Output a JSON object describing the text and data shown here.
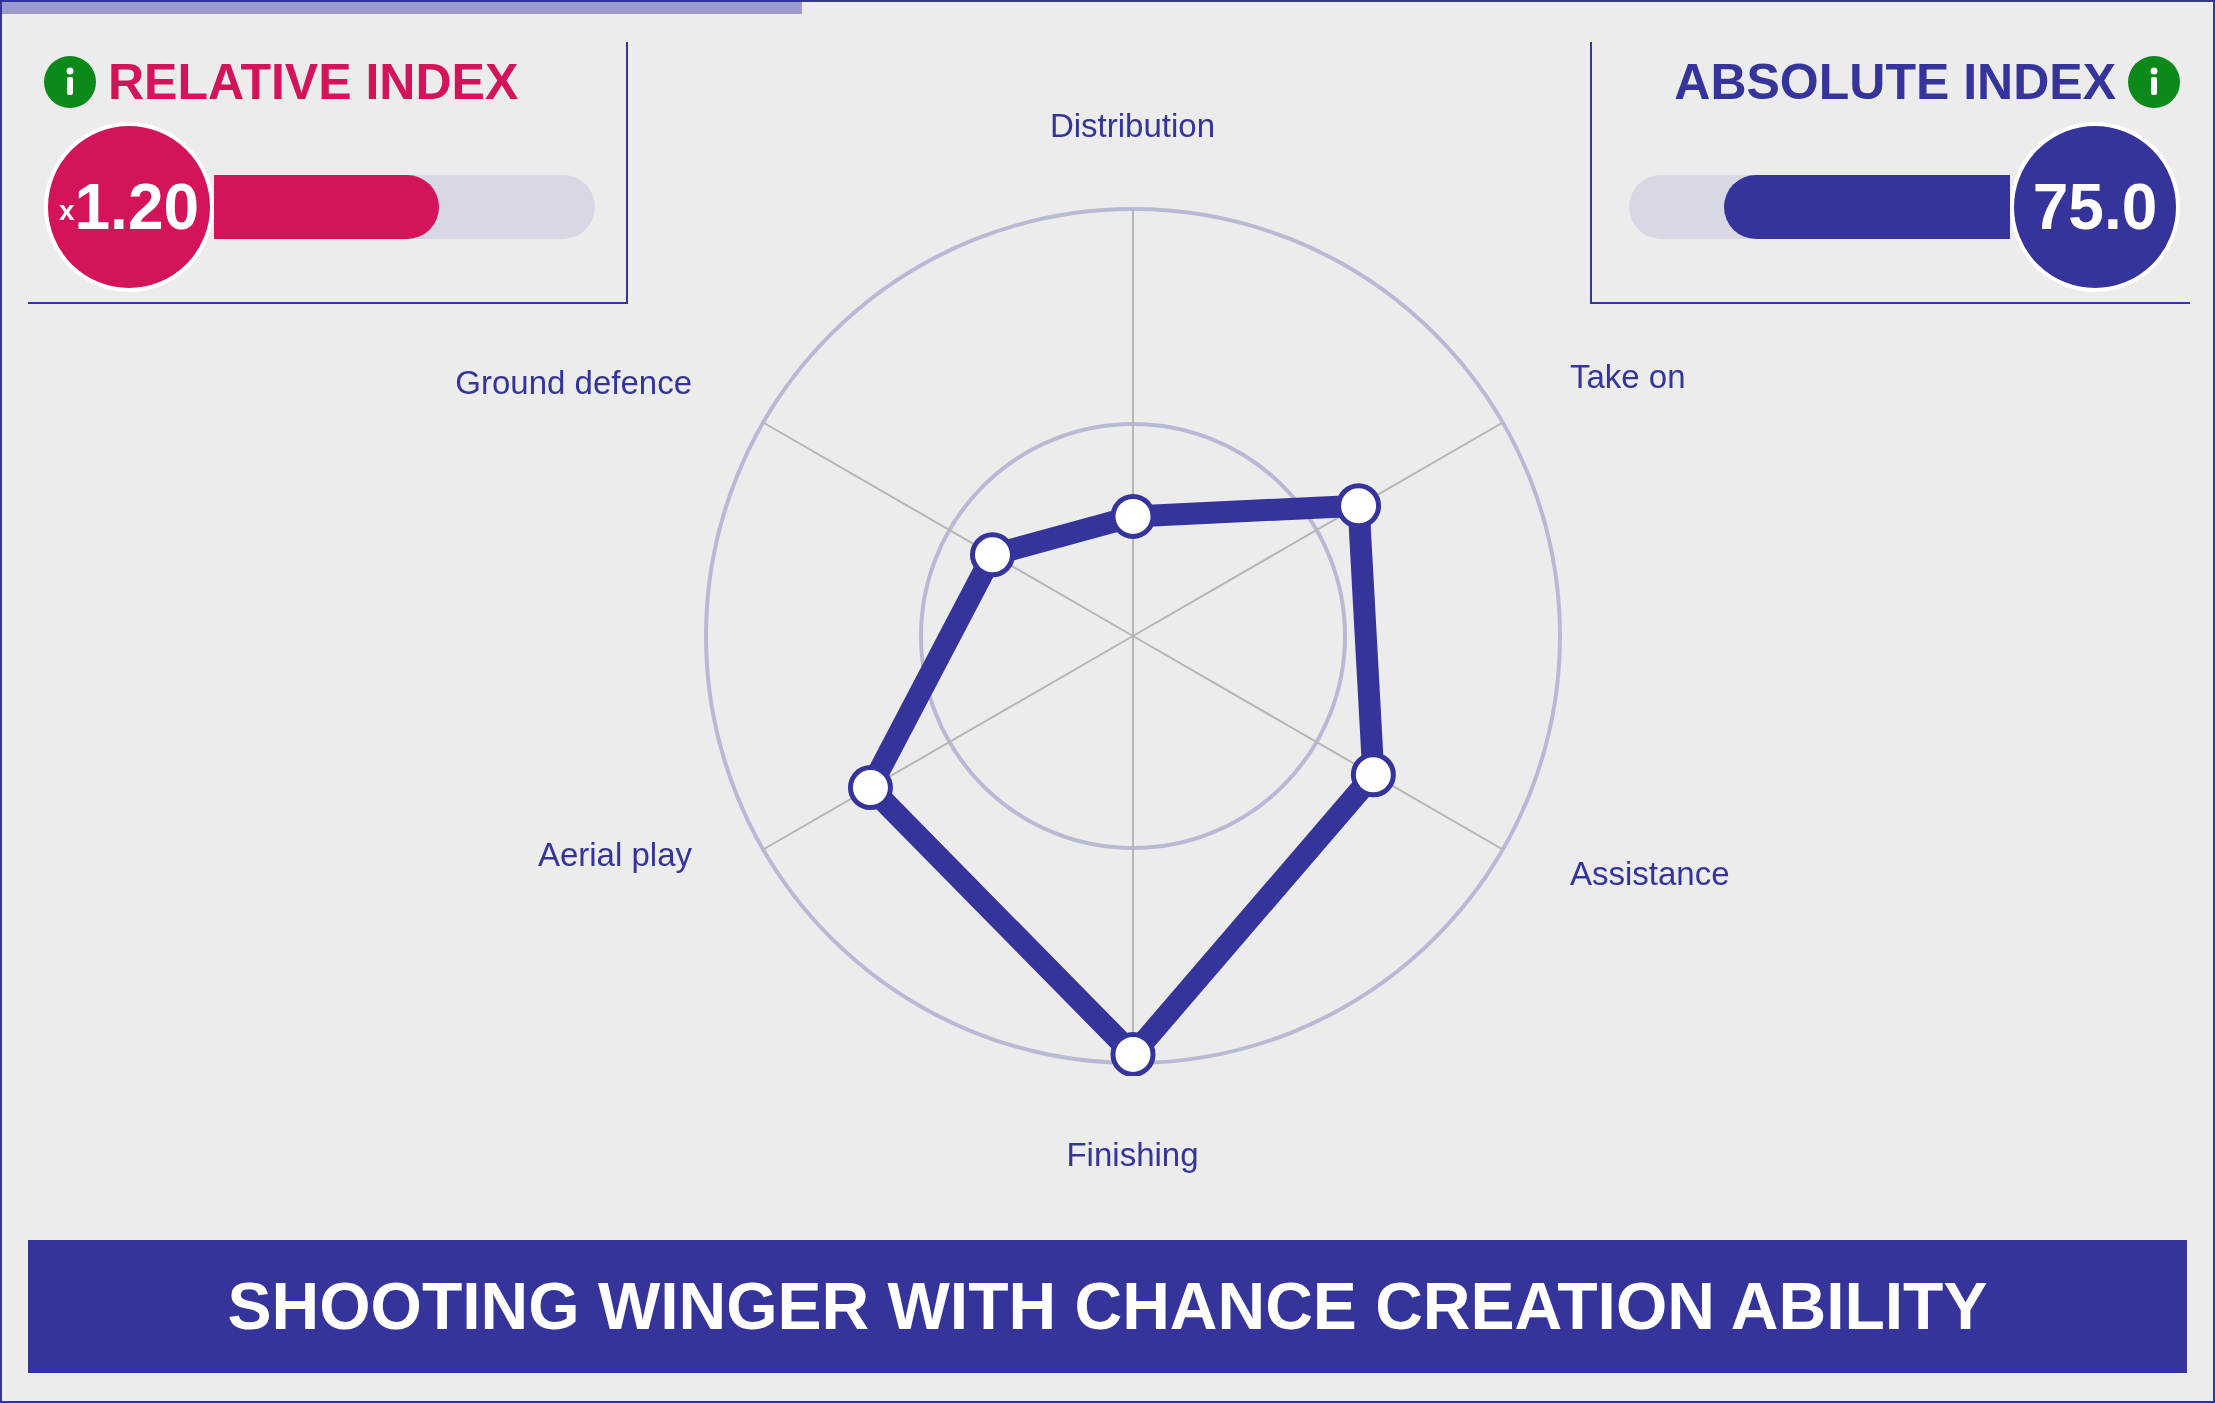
{
  "relative_index": {
    "title": "RELATIVE INDEX",
    "prefix": "x",
    "value": "1.20",
    "level": 0.59
  },
  "absolute_index": {
    "title": "ABSOLUTE INDEX",
    "value": "75.0",
    "level": 0.75
  },
  "radar": {
    "axes": [
      "Distribution",
      "Take on",
      "Assistance",
      "Finishing",
      "Aerial play",
      "Ground defence"
    ]
  },
  "banner": "SHOOTING WINGER WITH CHANCE CREATION ABILITY"
}
